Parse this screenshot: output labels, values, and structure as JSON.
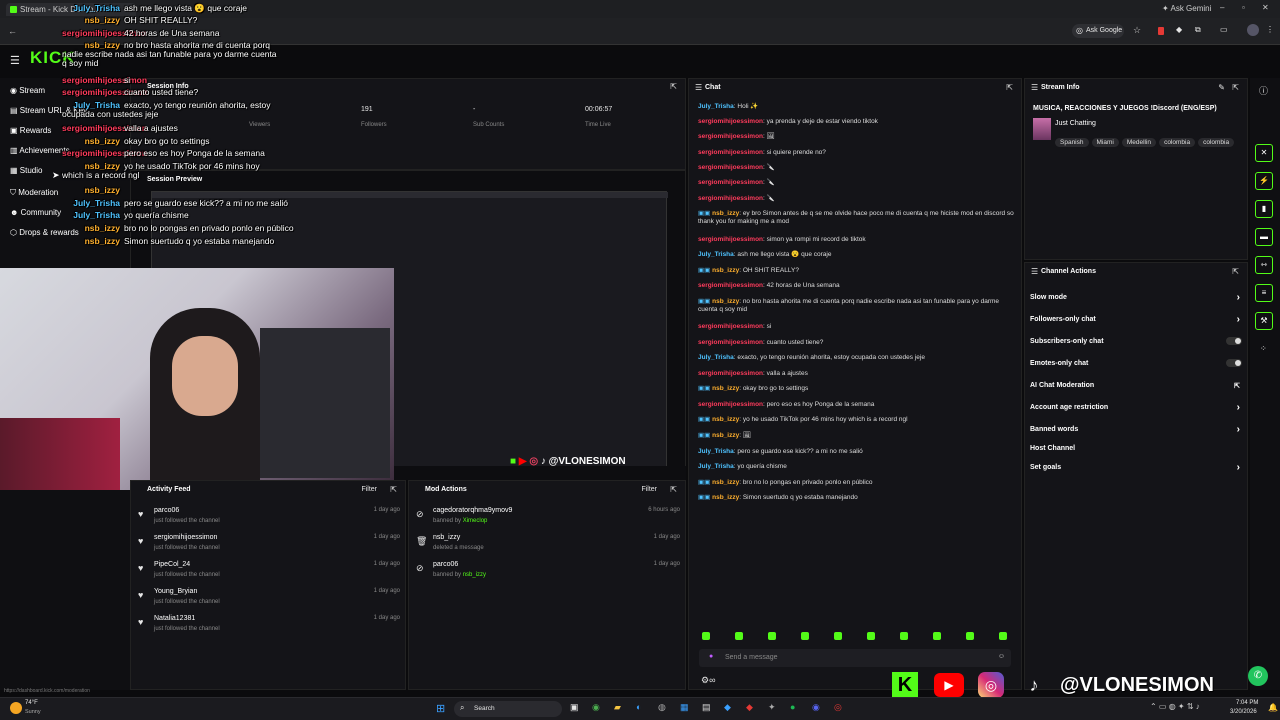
{
  "browser": {
    "tab_title": "Stream - Kick Dashb...",
    "gemini": "Ask Gemini",
    "ask_google": "Ask Google",
    "status_url": "https://dashboard.kick.com/moderation"
  },
  "logo": "KICK",
  "sidebar": {
    "items": [
      {
        "label": "Stream"
      },
      {
        "label": "Stream URL & Key"
      },
      {
        "label": "Rewards"
      },
      {
        "label": "Achievements"
      },
      {
        "label": "Studio"
      },
      {
        "label": "Moderation"
      },
      {
        "label": "Community"
      },
      {
        "label": "Drops & rewards"
      }
    ]
  },
  "session": {
    "title": "Session Info",
    "stats": [
      {
        "value": "",
        "label": "Viewers"
      },
      {
        "value": "191",
        "label": "Followers"
      },
      {
        "value": "-",
        "label": "Sub Counts"
      },
      {
        "value": "00:06:57",
        "label": "Time Live"
      }
    ]
  },
  "preview": {
    "title": "Session Preview"
  },
  "activity": {
    "title": "Activity Feed",
    "filter": "Filter",
    "items": [
      {
        "name": "parco06",
        "sub": "just followed the channel",
        "time": "1 day ago"
      },
      {
        "name": "sergiomihijoessimon",
        "sub": "just followed the channel",
        "time": "1 day ago"
      },
      {
        "name": "PipeCol_24",
        "sub": "just followed the channel",
        "time": "1 day ago"
      },
      {
        "name": "Young_Bryian",
        "sub": "just followed the channel",
        "time": "1 day ago"
      },
      {
        "name": "Natalia12381",
        "sub": "just followed the channel",
        "time": "1 day ago"
      }
    ]
  },
  "mod_actions": {
    "title": "Mod Actions",
    "filter": "Filter",
    "items": [
      {
        "name": "cagedoratorqhma9ymov9",
        "action": "banned by",
        "by": "Ximeclop",
        "time": "6 hours ago"
      },
      {
        "name": "nsb_izzy",
        "action": "deleted a message",
        "by": "",
        "time": "1 day ago"
      },
      {
        "name": "parco06",
        "action": "banned by",
        "by": "nsb_izzy",
        "time": "1 day ago"
      }
    ]
  },
  "chat": {
    "title": "Chat",
    "input_placeholder": "Send a message",
    "messages": [
      {
        "user": "July_Trisha",
        "color": "b",
        "text": ": Holi ✨"
      },
      {
        "user": "sergiomihijoessimon",
        "color": "r",
        "text": ": ya prenda y deje de estar viendo tiktok"
      },
      {
        "user": "sergiomihijoessimon",
        "color": "r",
        "text": ": 🖼"
      },
      {
        "user": "sergiomihijoessimon",
        "color": "r",
        "text": ": si quiere prende no?"
      },
      {
        "user": "sergiomihijoessimon",
        "color": "r",
        "text": ": 🔪"
      },
      {
        "user": "sergiomihijoessimon",
        "color": "r",
        "text": ": 🔪"
      },
      {
        "user": "sergiomihijoessimon",
        "color": "r",
        "text": ": 🔪"
      },
      {
        "user": "nsb_izzy",
        "color": "o",
        "text": ": ey bro Simon antes de q se me olvide hace poco me di cuenta q me hiciste mod en discord so thank you for making me a mod"
      },
      {
        "user": "sergiomihijoessimon",
        "color": "r",
        "text": ": simon ya rompi mi record de tiktok"
      },
      {
        "user": "July_Trisha",
        "color": "b",
        "text": ": ash me llego vista 😮 que coraje"
      },
      {
        "user": "nsb_izzy",
        "color": "o",
        "text": ": OH SHIT REALLY?"
      },
      {
        "user": "sergiomihijoessimon",
        "color": "r",
        "text": ": 42 horas de Una semana"
      },
      {
        "user": "nsb_izzy",
        "color": "o",
        "text": ": no bro hasta ahorita me di cuenta porq nadie escribe nada asi tan funable para yo darme cuenta q soy mid"
      },
      {
        "user": "sergiomihijoessimon",
        "color": "r",
        "text": ": si"
      },
      {
        "user": "sergiomihijoessimon",
        "color": "r",
        "text": ": cuanto usted tiene?"
      },
      {
        "user": "July_Trisha",
        "color": "b",
        "text": ": exacto, yo tengo reunión ahorita, estoy ocupada con ustedes jeje"
      },
      {
        "user": "sergiomihijoessimon",
        "color": "r",
        "text": ": valla a ajustes"
      },
      {
        "user": "nsb_izzy",
        "color": "o",
        "text": ": okay bro go to settings"
      },
      {
        "user": "sergiomihijoessimon",
        "color": "r",
        "text": ": pero eso es hoy Ponga de la semana"
      },
      {
        "user": "nsb_izzy",
        "color": "o",
        "text": ": yo he usado TikTok por 46 mins hoy which is a record ngl"
      },
      {
        "user": "nsb_izzy",
        "color": "o",
        "text": ": 🖼"
      },
      {
        "user": "July_Trisha",
        "color": "b",
        "text": ": pero se guardo ese kick?? a mi no me salió"
      },
      {
        "user": "July_Trisha",
        "color": "b",
        "text": ": yo quería chisme"
      },
      {
        "user": "nsb_izzy",
        "color": "o",
        "text": ": bro no lo pongas en privado ponlo en público"
      },
      {
        "user": "nsb_izzy",
        "color": "o",
        "text": ": Simon suertudo q yo estaba manejando"
      }
    ]
  },
  "overlay_chat": [
    {
      "user": "July_Trisha",
      "text": "ash me llego vista 😮 que coraje"
    },
    {
      "user": "nsb_izzy",
      "text": "OH SHIT REALLY?"
    },
    {
      "user": "sergiomihijoessimon",
      "text": "42 horas de Una semana"
    },
    {
      "user": "nsb_izzy",
      "text": "no bro hasta ahorita me di cuenta porq nadie escribe nada asi tan funable para yo darme cuenta q soy mid"
    },
    {
      "user": "sergiomihijoessimon",
      "text": "si"
    },
    {
      "user": "sergiomihijoessimon",
      "text": "cuanto usted tiene?"
    },
    {
      "user": "July_Trisha",
      "text": "exacto, yo tengo reunión ahorita, estoy ocupada con ustedes jeje"
    },
    {
      "user": "sergiomihijoessimon",
      "text": "valla a ajustes"
    },
    {
      "user": "nsb_izzy",
      "text": "okay bro go to settings"
    },
    {
      "user": "sergiomihijoessimon",
      "text": "pero eso es hoy Ponga de la semana"
    },
    {
      "user": "nsb_izzy",
      "text": "yo he usado TikTok por 46 mins hoy which is a record ngl"
    },
    {
      "user": "nsb_izzy",
      "text": ""
    },
    {
      "user": "July_Trisha",
      "text": "pero se guardo ese kick?? a mi no me salió"
    },
    {
      "user": "July_Trisha",
      "text": "yo quería chisme"
    },
    {
      "user": "nsb_izzy",
      "text": "bro no lo pongas en privado ponlo en público"
    },
    {
      "user": "nsb_izzy",
      "text": "Simon suertudo q yo estaba manejando"
    }
  ],
  "stream_info": {
    "title": "Stream Info",
    "stream_title": "MUSICA, REACCIONES Y JUEGOS !Discord (ENG/ESP)",
    "category": "Just Chatting",
    "tags": [
      "Spanish",
      "Miami",
      "Medellin",
      "colombia",
      "colombia"
    ]
  },
  "channel_actions": {
    "title": "Channel Actions",
    "items": [
      {
        "label": "Slow mode",
        "control": "arrow"
      },
      {
        "label": "Followers-only chat",
        "control": "arrow"
      },
      {
        "label": "Subscribers-only chat",
        "control": "toggle"
      },
      {
        "label": "Emotes-only chat",
        "control": "toggle"
      },
      {
        "label": "AI Chat Moderation",
        "control": "link"
      },
      {
        "label": "Account age restriction",
        "control": "arrow"
      },
      {
        "label": "Banned words",
        "control": "arrow"
      },
      {
        "label": "Host Channel",
        "control": "none"
      },
      {
        "label": "Set goals",
        "control": "arrow"
      }
    ]
  },
  "socials": {
    "handle": "@VLONESIMON"
  },
  "taskbar": {
    "weather_temp": "74°F",
    "weather_desc": "Sunny",
    "search": "Search",
    "time": "7:04 PM",
    "date": "3/20/2026"
  },
  "colors": {
    "kick_green": "#53fc18",
    "bg": "#0b0b0d",
    "panel": "#141418"
  }
}
